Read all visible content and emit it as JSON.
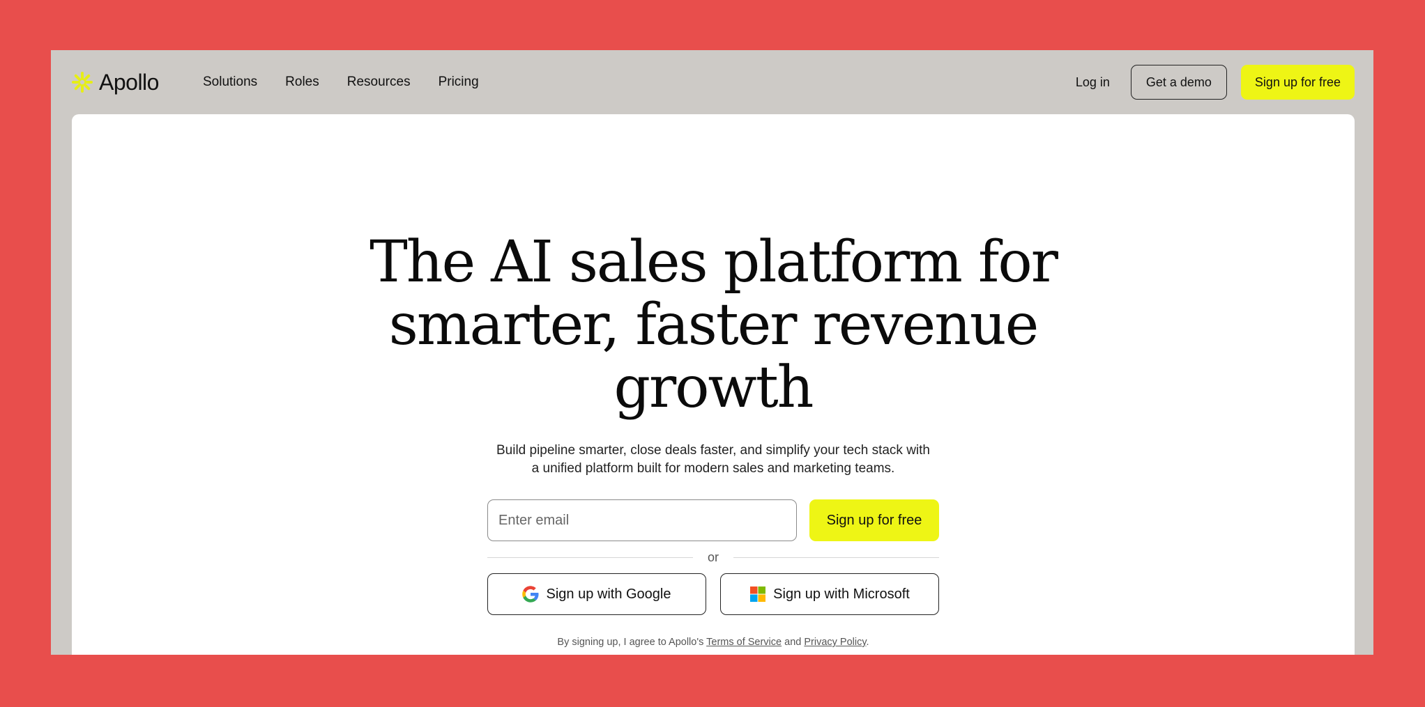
{
  "brand": {
    "name": "Apollo",
    "accent": "#eef515",
    "background": "#e84e4c"
  },
  "nav": {
    "links": [
      "Solutions",
      "Roles",
      "Resources",
      "Pricing"
    ],
    "login": "Log in",
    "demo": "Get a demo",
    "signup": "Sign up for free"
  },
  "hero": {
    "title_lines": [
      "The AI sales platform for",
      "smarter, faster revenue",
      "growth"
    ],
    "subtitle_lines": [
      "Build pipeline smarter, close deals faster, and simplify your tech stack with",
      "a unified platform built for modern sales and marketing teams."
    ]
  },
  "form": {
    "email_placeholder": "Enter email",
    "email_value": "",
    "submit": "Sign up for free",
    "or": "or",
    "google": "Sign up with Google",
    "microsoft": "Sign up with Microsoft",
    "google_icon": "google-icon",
    "microsoft_icon": "microsoft-icon"
  },
  "legal": {
    "prefix": "By signing up, I agree to Apollo's ",
    "terms": "Terms of Service",
    "and": " and ",
    "privacy": "Privacy Policy",
    "suffix": "."
  }
}
